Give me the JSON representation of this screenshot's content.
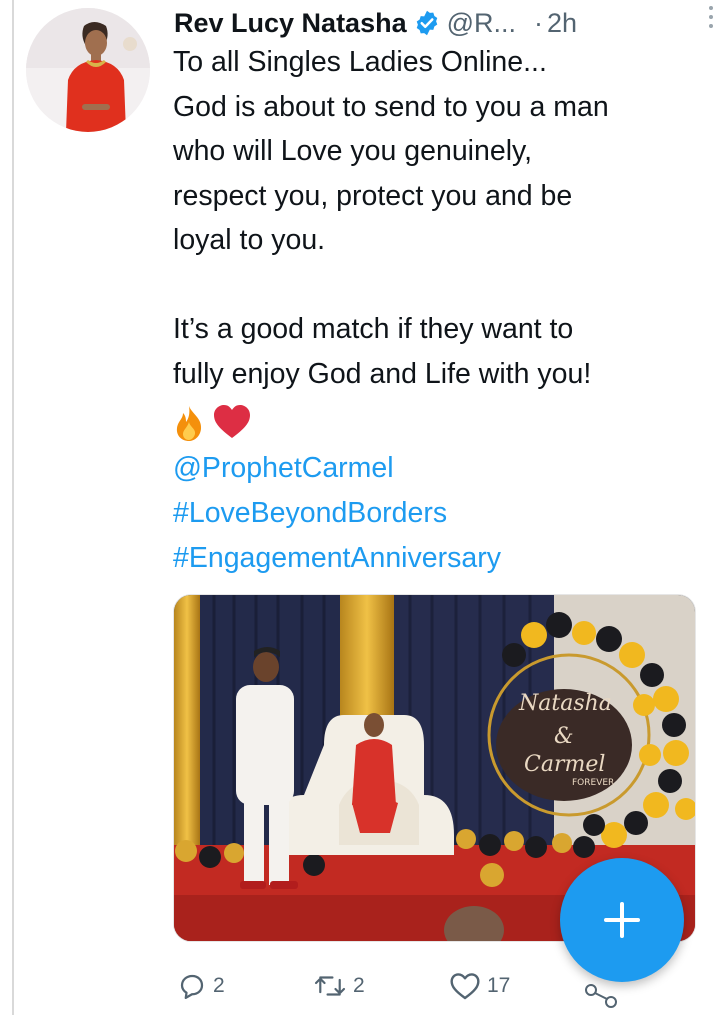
{
  "tweet": {
    "author_name": "Rev Lucy Natasha",
    "handle": "@R...",
    "separator": "·",
    "time": "2h",
    "lines": [
      "To all Singles Ladies Online...",
      "God is about to send to you a man",
      "who will Love you genuinely,",
      "respect you, protect you and be",
      "loyal to you."
    ],
    "lines2": [
      "It’s a good match if they want to",
      "fully enjoy God and Life with you!"
    ],
    "emojis": [
      "fire-emoji",
      "heart-emoji"
    ],
    "mention": "@ProphetCarmel",
    "hashtags": [
      "#LoveBeyondBorders",
      "#EngagementAnniversary"
    ],
    "media_sign": {
      "line1": "Natasha",
      "amp": "&",
      "line2": "Carmel",
      "line3": "FOREVER"
    }
  },
  "actions": {
    "replies": "2",
    "retweets": "2",
    "likes": "17"
  },
  "colors": {
    "link": "#1d9bf0",
    "muted": "#536471",
    "verified": "#1d9bf0",
    "fab": "#1d9bf0"
  }
}
